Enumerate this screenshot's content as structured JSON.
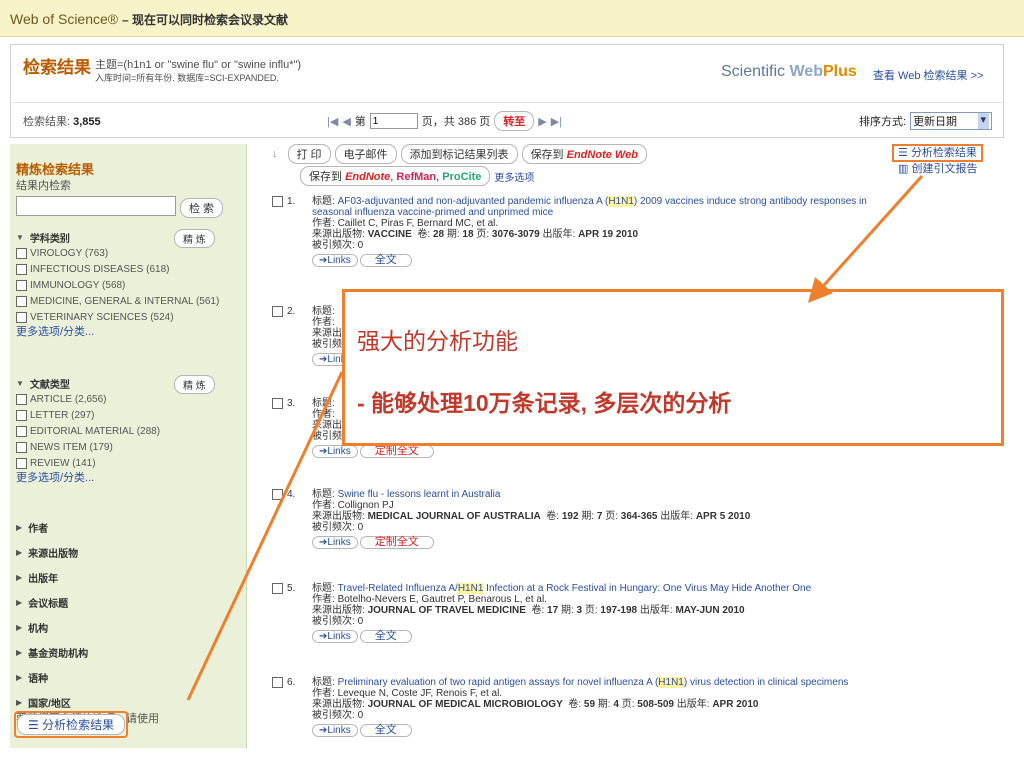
{
  "topbar": {
    "brand": "Web of Science®",
    "subtitle": "– 现在可以同时检索会议录文献"
  },
  "header": {
    "title": "检索结果",
    "query_line1": "主题=(h1n1 or \"swine flu\" or \"swine influ*\")",
    "query_line2": "入库时间=所有年份. 数据库=SCI-EXPANDED.",
    "scientific": "Scientific",
    "web": "Web",
    "plus": "Plus",
    "beta": "BETA",
    "view_link": "查看 Web 检索结果 >>"
  },
  "nav": {
    "results_label": "检索结果:",
    "results_count": "3,855",
    "page_prefix": "第",
    "page_value": "1",
    "page_suffix": "页，共 386 页",
    "goto": "转至",
    "sort_label": "排序方式:",
    "sort_value": "更新日期"
  },
  "toolbar": {
    "print": "打 印",
    "email": "电子邮件",
    "add_marked": "添加到标记结果列表",
    "save_to": "保存到",
    "endnote_web": "EndNote Web",
    "save_to2": "保存到",
    "endnote": "EndNote",
    "refman": "RefMan",
    "procite": "ProCite",
    "more": "更多选项"
  },
  "analysis": {
    "analyze": "分析检索结果",
    "citation_report": "创建引文报告"
  },
  "sidebar": {
    "title": "精炼检索结果",
    "within": "结果内检索",
    "search_btn": "检 索",
    "subject_label": "学科类别",
    "refine": "精 炼",
    "subjects": [
      "VIROLOGY (763)",
      "INFECTIOUS DISEASES (618)",
      "IMMUNOLOGY (568)",
      "MEDICINE, GENERAL & INTERNAL (561)",
      "VETERINARY SCIENCES (524)"
    ],
    "more": "更多选项/分类...",
    "doctype_label": "文献类型",
    "doctypes": [
      "ARTICLE (2,656)",
      "LETTER (297)",
      "EDITORIAL MATERIAL (288)",
      "NEWS ITEM (179)",
      "REVIEW (141)"
    ],
    "more2": "更多选项/分类...",
    "sections": [
      "作者",
      "来源出版物",
      "出版年",
      "会议标题",
      "机构",
      "基金资助机构",
      "语种"
    ],
    "country": "国家/地区",
    "tip": "要获得更多精炼选项，请使用",
    "analyze_btn": "分析检索结果"
  },
  "results": [
    {
      "n": "1.",
      "title_pre": "AF03-adjuvanted and non-adjuvanted pandemic influenza A (",
      "hl": "H1N1",
      "title_post": ") 2009 vaccines induce strong antibody responses in",
      "title_line2": "seasonal influenza vaccine-primed and unprimed mice",
      "authors": "Caillet C, Piras F, Bernard MC, et al.",
      "source": "VACCINE",
      "vol": "28",
      "issue": "18",
      "pages": "3076-3079",
      "date": "APR 19 2010",
      "cited": "0",
      "full": "全文"
    },
    {
      "n": "2.",
      "title_pre": "",
      "hl": "",
      "title_post": "",
      "title_line2": "",
      "authors": "",
      "source": "",
      "vol": "",
      "issue": "",
      "pages": "",
      "date": "",
      "cited": "",
      "full": ""
    },
    {
      "n": "3.",
      "title_pre": "",
      "hl": "",
      "title_post": "",
      "title_line2": "",
      "authors": "",
      "source": "",
      "vol": "",
      "issue": "",
      "pages": "",
      "date": "",
      "cited": "0",
      "full": "定制全文"
    },
    {
      "n": "4.",
      "title_pre": "Swine flu - lessons learnt in Australia",
      "hl": "",
      "title_post": "",
      "title_line2": "",
      "authors": "Collignon PJ",
      "source": "MEDICAL JOURNAL OF AUSTRALIA",
      "vol": "192",
      "issue": "7",
      "pages": "364-365",
      "date": "APR 5 2010",
      "cited": "0",
      "full": "定制全文"
    },
    {
      "n": "5.",
      "title_pre": "Travel-Related Influenza A/",
      "hl": "H1N1",
      "title_post": " Infection at a Rock Festival in Hungary: One Virus May Hide Another One",
      "title_line2": "",
      "authors": "Botelho-Nevers E, Gautret P, Benarous L, et al.",
      "source": "JOURNAL OF TRAVEL MEDICINE",
      "vol": "17",
      "issue": "3",
      "pages": "197-198",
      "date": "MAY-JUN 2010",
      "cited": "0",
      "full": "全文"
    },
    {
      "n": "6.",
      "title_pre": "Preliminary evaluation of two rapid antigen assays for novel influenza A (",
      "hl": "H1N1",
      "title_post": ") virus detection in clinical specimens",
      "title_line2": "",
      "authors": "Leveque N, Coste JF, Renois F, et al.",
      "source": "JOURNAL OF MEDICAL MICROBIOLOGY",
      "vol": "59",
      "issue": "4",
      "pages": "508-509",
      "date": "APR 2010",
      "cited": "0",
      "full": "全文"
    }
  ],
  "labels": {
    "title": "标题:",
    "authors": "作者:",
    "source": "来源出版物:",
    "vol": "卷:",
    "issue": "期:",
    "pages": "页:",
    "date": "出版年:",
    "cited": "被引频次:",
    "links": "➔Links"
  },
  "overlay": {
    "line1": "强大的分析功能",
    "line2": "- 能够处理10万条记录, 多层次的分析"
  },
  "colors": {
    "accent": "#ee7f2d",
    "link": "#2a4fa0",
    "sidebar_bg": "#eaf1d8"
  }
}
